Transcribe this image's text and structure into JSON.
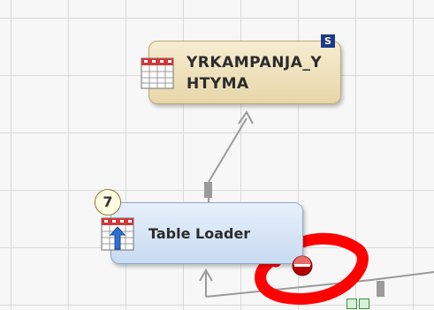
{
  "diagram": {
    "target_table": {
      "name": "YRKAMPANJA_YHTYMA",
      "badge": "S"
    },
    "transform": {
      "name": "Table Loader",
      "step_number": "7"
    }
  },
  "colors": {
    "target_fill": "#eee0b9",
    "transform_fill": "#d7e5f6",
    "annotation": "#ff0000",
    "status_dot": "#c00000"
  }
}
